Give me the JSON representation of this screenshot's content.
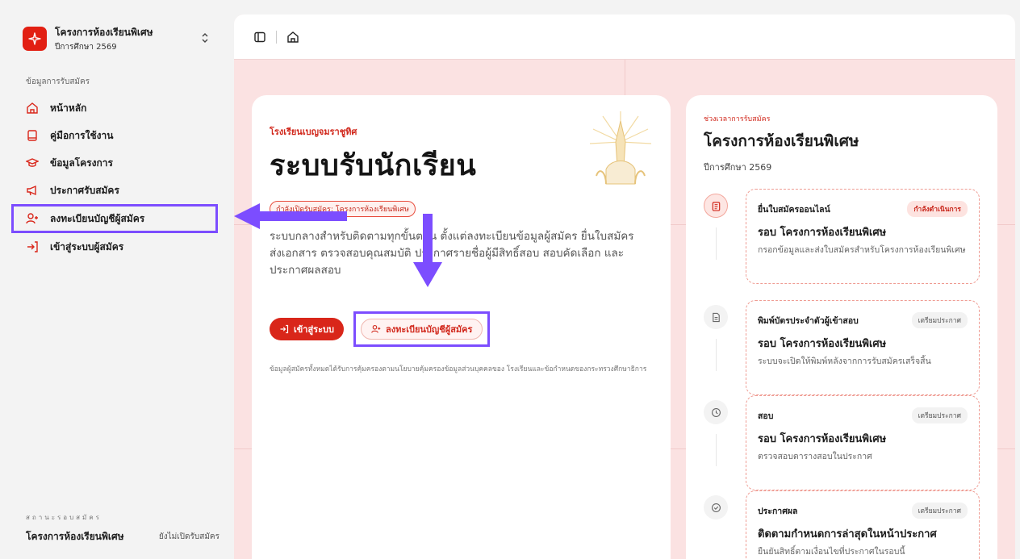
{
  "brand": {
    "title": "โครงการห้องเรียนพิเศษ",
    "subtitle": "ปีการศึกษา 2569",
    "logo_icon": "sparkle-icon",
    "switch_icon": "chevron-updown-icon"
  },
  "sidebar": {
    "section_label": "ข้อมูลการรับสมัคร",
    "items": [
      {
        "label": "หน้าหลัก",
        "icon": "home-icon"
      },
      {
        "label": "คู่มือการใช้งาน",
        "icon": "book-icon"
      },
      {
        "label": "ข้อมูลโครงการ",
        "icon": "graduation-cap-icon"
      },
      {
        "label": "ประกาศรับสมัคร",
        "icon": "megaphone-icon"
      },
      {
        "label": "ลงทะเบียนบัญชีผู้สมัคร",
        "icon": "user-plus-icon"
      },
      {
        "label": "เข้าสู่ระบบผู้สมัคร",
        "icon": "login-icon"
      }
    ],
    "status_label": "สถานะรอบสมัคร",
    "status_name": "โครงการห้องเรียนพิเศษ",
    "status_value": "ยังไม่เปิดรับสมัคร"
  },
  "topbar": {
    "sidebar_toggle_icon": "sidebar-icon",
    "home_icon": "home-icon"
  },
  "hero": {
    "school": "โรงเรียนเบญจมราชูทิศ",
    "title": "ระบบรับนักเรียน",
    "badge": "กำลังเปิดรับสมัคร: โครงการห้องเรียนพิเศษ",
    "description": "ระบบกลางสำหรับติดตามทุกขั้นตอน ตั้งแต่ลงทะเบียนข้อมูลผู้สมัคร ยื่นใบสมัคร ส่งเอกสาร ตรวจสอบคุณสมบัติ ประกาศรายชื่อผู้มีสิทธิ์สอบ สอบคัดเลือก และประกาศผลสอบ",
    "login_button": "เข้าสู่ระบบ",
    "register_button": "ลงทะเบียนบัญชีผู้สมัคร",
    "note": "ข้อมูลผู้สมัครทั้งหมดได้รับการคุ้มครองตามนโยบายคุ้มครองข้อมูลส่วนบุคคลของ โรงเรียนและข้อกำหนดของกระทรวงศึกษาธิการ"
  },
  "timeline": {
    "label": "ช่วงเวลาการรับสมัคร",
    "title": "โครงการห้องเรียนพิเศษ",
    "subtitle": "ปีการศึกษา 2569",
    "items": [
      {
        "name": "ยื่นใบสมัครออนไลน์",
        "badge": "กำลังดำเนินการ",
        "round": "รอบ โครงการห้องเรียนพิเศษ",
        "desc": "กรอกข้อมูลและส่งใบสมัครสำหรับโครงการห้องเรียนพิเศษ",
        "icon": "clipboard-icon",
        "current": true
      },
      {
        "name": "พิมพ์บัตรประจำตัวผู้เข้าสอบ",
        "badge": "เตรียมประกาศ",
        "round": "รอบ โครงการห้องเรียนพิเศษ",
        "desc": "ระบบจะเปิดให้พิมพ์หลังจากการรับสมัครเสร็จสิ้น",
        "icon": "document-icon",
        "current": false
      },
      {
        "name": "สอบ",
        "badge": "เตรียมประกาศ",
        "round": "รอบ โครงการห้องเรียนพิเศษ",
        "desc": "ตรวจสอบตารางสอบในประกาศ",
        "icon": "clock-icon",
        "current": false
      },
      {
        "name": "ประกาศผล",
        "badge": "เตรียมประกาศ",
        "round": "ติดตามกำหนดการล่าสุดในหน้าประกาศ",
        "desc": "ยืนยันสิทธิ์ตามเงื่อนไขที่ประกาศในรอบนี้",
        "icon": "check-circle-icon",
        "current": false
      }
    ]
  },
  "colors": {
    "accent": "#d9261a",
    "annotation": "#7c4dff",
    "background_pink": "#fbe2e2"
  }
}
